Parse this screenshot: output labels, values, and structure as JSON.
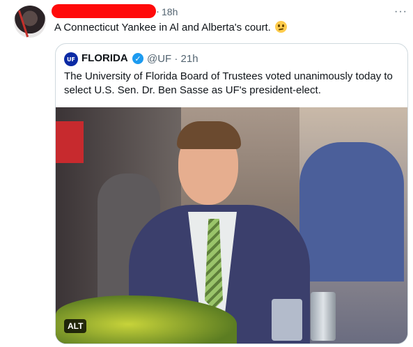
{
  "tweet": {
    "time": "18h",
    "dot": "·",
    "more": "···",
    "text": "A Connecticut Yankee in Al and Alberta's court.",
    "emoji": "confused-face"
  },
  "quoted": {
    "avatar_text": "UF",
    "name": "FLORIDA",
    "verified": "✓",
    "handle_time": "@UF · 21h",
    "text": "The University of Florida Board of Trustees voted unanimously today to select U.S. Sen. Dr. Ben Sasse as UF's president-elect.",
    "media": {
      "alt_label": "ALT"
    }
  },
  "colors": {
    "redaction": "#ff0a0a",
    "verified_blue": "#1d9bf0",
    "secondary_text": "#536471",
    "border": "#cfd9de"
  }
}
